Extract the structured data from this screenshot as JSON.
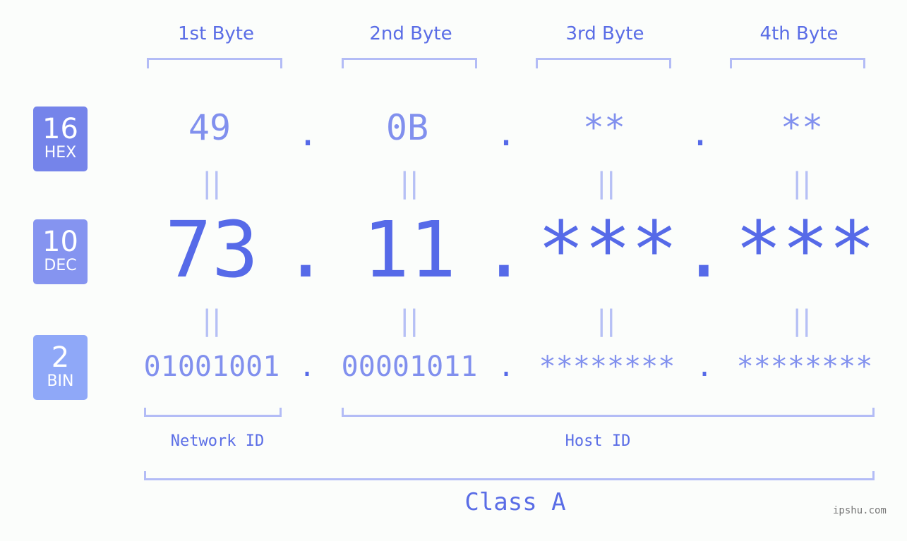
{
  "badges": [
    {
      "number": "16",
      "label": "HEX",
      "color": "#7584ea"
    },
    {
      "number": "10",
      "label": "DEC",
      "color": "#8594f0"
    },
    {
      "number": "2",
      "label": "BIN",
      "color": "#8fa8f8"
    }
  ],
  "byte_headers": [
    "1st Byte",
    "2nd Byte",
    "3rd Byte",
    "4th Byte"
  ],
  "hex": [
    "49",
    "0B",
    "**",
    "**"
  ],
  "dec": [
    "73",
    "11",
    "***",
    "***"
  ],
  "bin": [
    "01001001",
    "00001011",
    "********",
    "********"
  ],
  "separator": ".",
  "equals": "||",
  "labels": {
    "network_id": "Network ID",
    "host_id": "Host ID",
    "class": "Class A"
  },
  "watermark": "ipshu.com",
  "colors": {
    "accent": "#566ae8",
    "light": "#8190ee",
    "bracket": "#b3bcf6",
    "background": "#fbfdfb"
  }
}
